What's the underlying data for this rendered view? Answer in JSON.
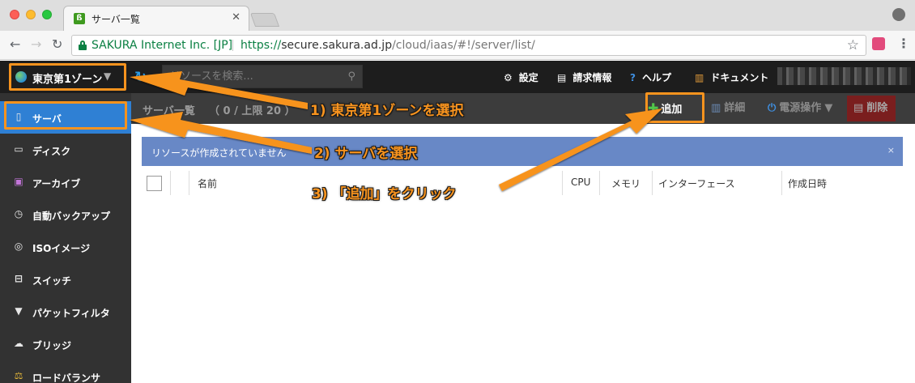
{
  "browser": {
    "tab_title": "サーバ一覧",
    "tab_favicon": "sakura-favicon",
    "ev_label": "SAKURA Internet Inc. [JP]",
    "url_scheme": "https://",
    "url_host": "secure.sakura.ad.jp",
    "url_path": "/cloud/iaas/#!/server/list/"
  },
  "header": {
    "zone": "東京第1ゾーン",
    "search_placeholder": "リソースを検索...",
    "nav": [
      {
        "icon": "gear-icon",
        "label": "設定"
      },
      {
        "icon": "invoice-icon",
        "label": "請求情報"
      },
      {
        "icon": "help-icon",
        "label": "ヘルプ"
      },
      {
        "icon": "document-icon",
        "label": "ドキュメント"
      }
    ]
  },
  "sidebar": {
    "items": [
      {
        "icon": "server-icon",
        "label": "サーバ",
        "active": true
      },
      {
        "icon": "disk-icon",
        "label": "ディスク"
      },
      {
        "icon": "archive-icon",
        "label": "アーカイブ"
      },
      {
        "icon": "clock-icon",
        "label": "自動バックアップ"
      },
      {
        "icon": "cd-icon",
        "label": "ISOイメージ"
      },
      {
        "icon": "switch-icon",
        "label": "スイッチ"
      },
      {
        "icon": "filter-icon",
        "label": "パケットフィルタ"
      },
      {
        "icon": "bridge-icon",
        "label": "ブリッジ"
      },
      {
        "icon": "balance-icon",
        "label": "ロードバランサ"
      }
    ]
  },
  "toolbar": {
    "page_title": "サーバ一覧",
    "count": "（ 0 / 上限 20 ）",
    "add_label": "追加",
    "detail_label": "詳細",
    "power_label": "電源操作",
    "delete_label": "削除"
  },
  "info": {
    "message": "リソースが作成されていません",
    "close": "×"
  },
  "table": {
    "headers": [
      "名前",
      "CPU",
      "メモリ",
      "インターフェース",
      "作成日時"
    ]
  },
  "annotations": {
    "step1": "1) 東京第1ゾーンを選択",
    "step2": "2) サーバを選択",
    "step3": "3) 「追加」をクリック",
    "color": "#f7931e"
  }
}
